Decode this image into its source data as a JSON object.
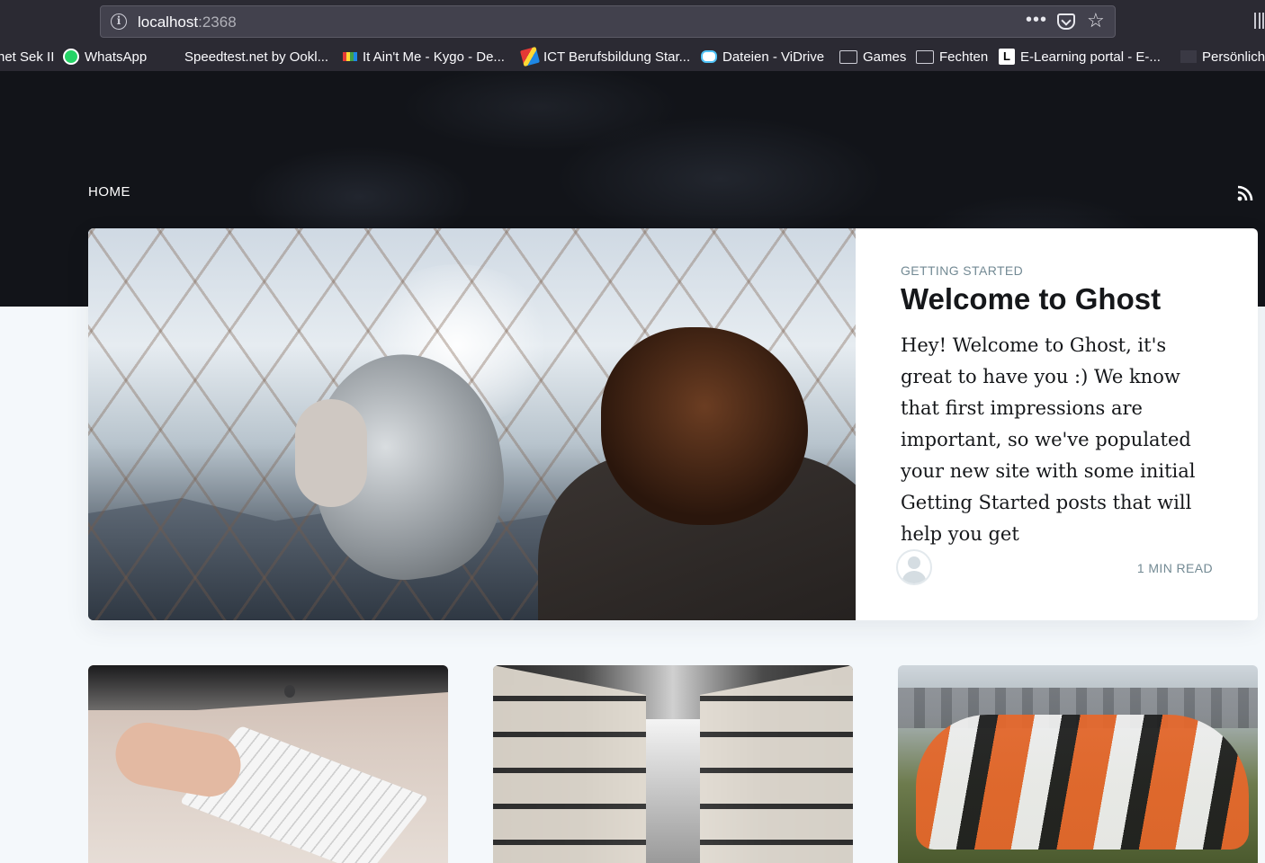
{
  "browser": {
    "url_host": "localhost",
    "url_port": ":2368",
    "page_actions": "•••",
    "star": "☆",
    "bookmarks": [
      {
        "label": "net Sek II",
        "icon": "none"
      },
      {
        "label": "WhatsApp",
        "icon": "whatsapp-icon"
      },
      {
        "label": "Speedtest.net by Ookl...",
        "icon": "none"
      },
      {
        "label": "It Ain't Me - Kygo - De...",
        "icon": "kygo-icon"
      },
      {
        "label": "ICT Berufsbildung Star...",
        "icon": "ict-icon"
      },
      {
        "label": "Dateien - ViDrive",
        "icon": "cloud-icon"
      },
      {
        "label": "Games",
        "icon": "folder-icon"
      },
      {
        "label": "Fechten",
        "icon": "folder-icon"
      },
      {
        "label": "E-Learning portal - E-...",
        "icon": "l-icon"
      },
      {
        "label": "Persönliche",
        "icon": "p-icon"
      }
    ]
  },
  "site": {
    "nav_home": "HOME",
    "hero": {
      "tag": "GETTING STARTED",
      "title": "Welcome to Ghost",
      "excerpt": "Hey! Welcome to Ghost, it's great to have you :) We know that first impressions are important, so we've populated your new site with some initial Getting Started posts that will help you get",
      "reading_time": "1 MIN READ"
    }
  },
  "colors": {
    "header_bg": "#121419",
    "page_bg": "#f4f8fb",
    "tag_color": "#738a94",
    "title_color": "#15171a"
  }
}
